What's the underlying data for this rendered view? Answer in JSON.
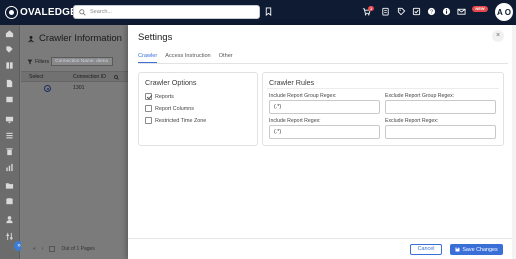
{
  "topbar": {
    "brand": "OVALEDGE",
    "search_placeholder": "Search...",
    "notification_badge": "1",
    "alert_badge": "NEW",
    "avatar_initials": "A O"
  },
  "background_page": {
    "title": "Crawler Information",
    "filters_label": "Filters",
    "filter_chip": "Connection Name: demo",
    "columns": [
      "Select",
      "Connection ID"
    ],
    "row": {
      "connection_id": "1301"
    },
    "pager": {
      "text": "Out of 1 Pages"
    }
  },
  "settings": {
    "title": "Settings",
    "close": "×",
    "tabs": [
      "Crawler",
      "Access Instruction",
      "Other"
    ],
    "active_tab": 0,
    "crawler_options": {
      "title": "Crawler Options",
      "items": [
        {
          "label": "Reports",
          "checked": true
        },
        {
          "label": "Report Columns",
          "checked": false
        },
        {
          "label": "Restricted Time Zone",
          "checked": false
        }
      ]
    },
    "crawler_rules": {
      "title": "Crawler Rules",
      "fields": [
        {
          "label": "Include Report Group Regex:",
          "value": "(.*)"
        },
        {
          "label": "Exclude Report Group Regex:",
          "value": ""
        },
        {
          "label": "Include Report Regex:",
          "value": "(.*)"
        },
        {
          "label": "Exclude Report Regex:",
          "value": ""
        }
      ]
    },
    "buttons": {
      "cancel": "Cancel",
      "save": "Save Changes"
    }
  },
  "colors": {
    "accent": "#3a6fd8",
    "topbar": "#0e1b33",
    "badge": "#e5484d"
  }
}
